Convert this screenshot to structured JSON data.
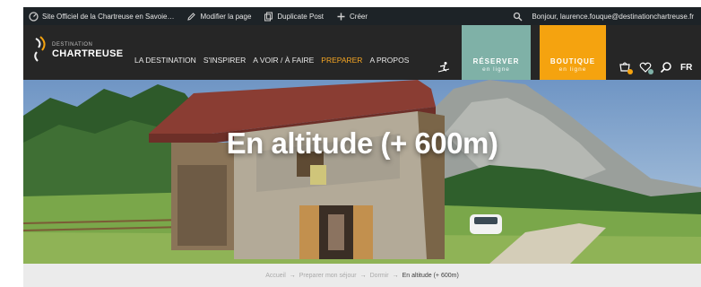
{
  "admin_bar": {
    "site_name": "Site Officiel de la Chartreuse en Savoie…",
    "edit_page": "Modifier la page",
    "duplicate": "Duplicate Post",
    "new": "Créer",
    "greeting": "Bonjour, laurence.fouque@destinationchartreuse.fr"
  },
  "header": {
    "logo_small": "DESTINATION",
    "logo_big": "CHARTREUSE",
    "nav": [
      "LA DESTINATION",
      "S'INSPIRER",
      "A VOIR / À FAIRE",
      "PREPARER",
      "A PROPOS"
    ],
    "active_nav": "PREPARER",
    "reserve": {
      "title": "RÉSERVER",
      "subtitle": "en ligne",
      "color": "#7fb1a7"
    },
    "boutique": {
      "title": "BOUTIQUE",
      "subtitle": "en ligne",
      "color": "#f5a30f"
    },
    "icons": [
      "ski-icon",
      "cart-icon",
      "heart-icon",
      "search-icon"
    ],
    "lang": "FR"
  },
  "hero": {
    "title": "En altitude (+ 600m)"
  },
  "breadcrumb": {
    "items": [
      "Accueil",
      "Preparer mon séjour",
      "Dormir",
      "En altitude (+ 600m)"
    ],
    "separator": "→"
  }
}
